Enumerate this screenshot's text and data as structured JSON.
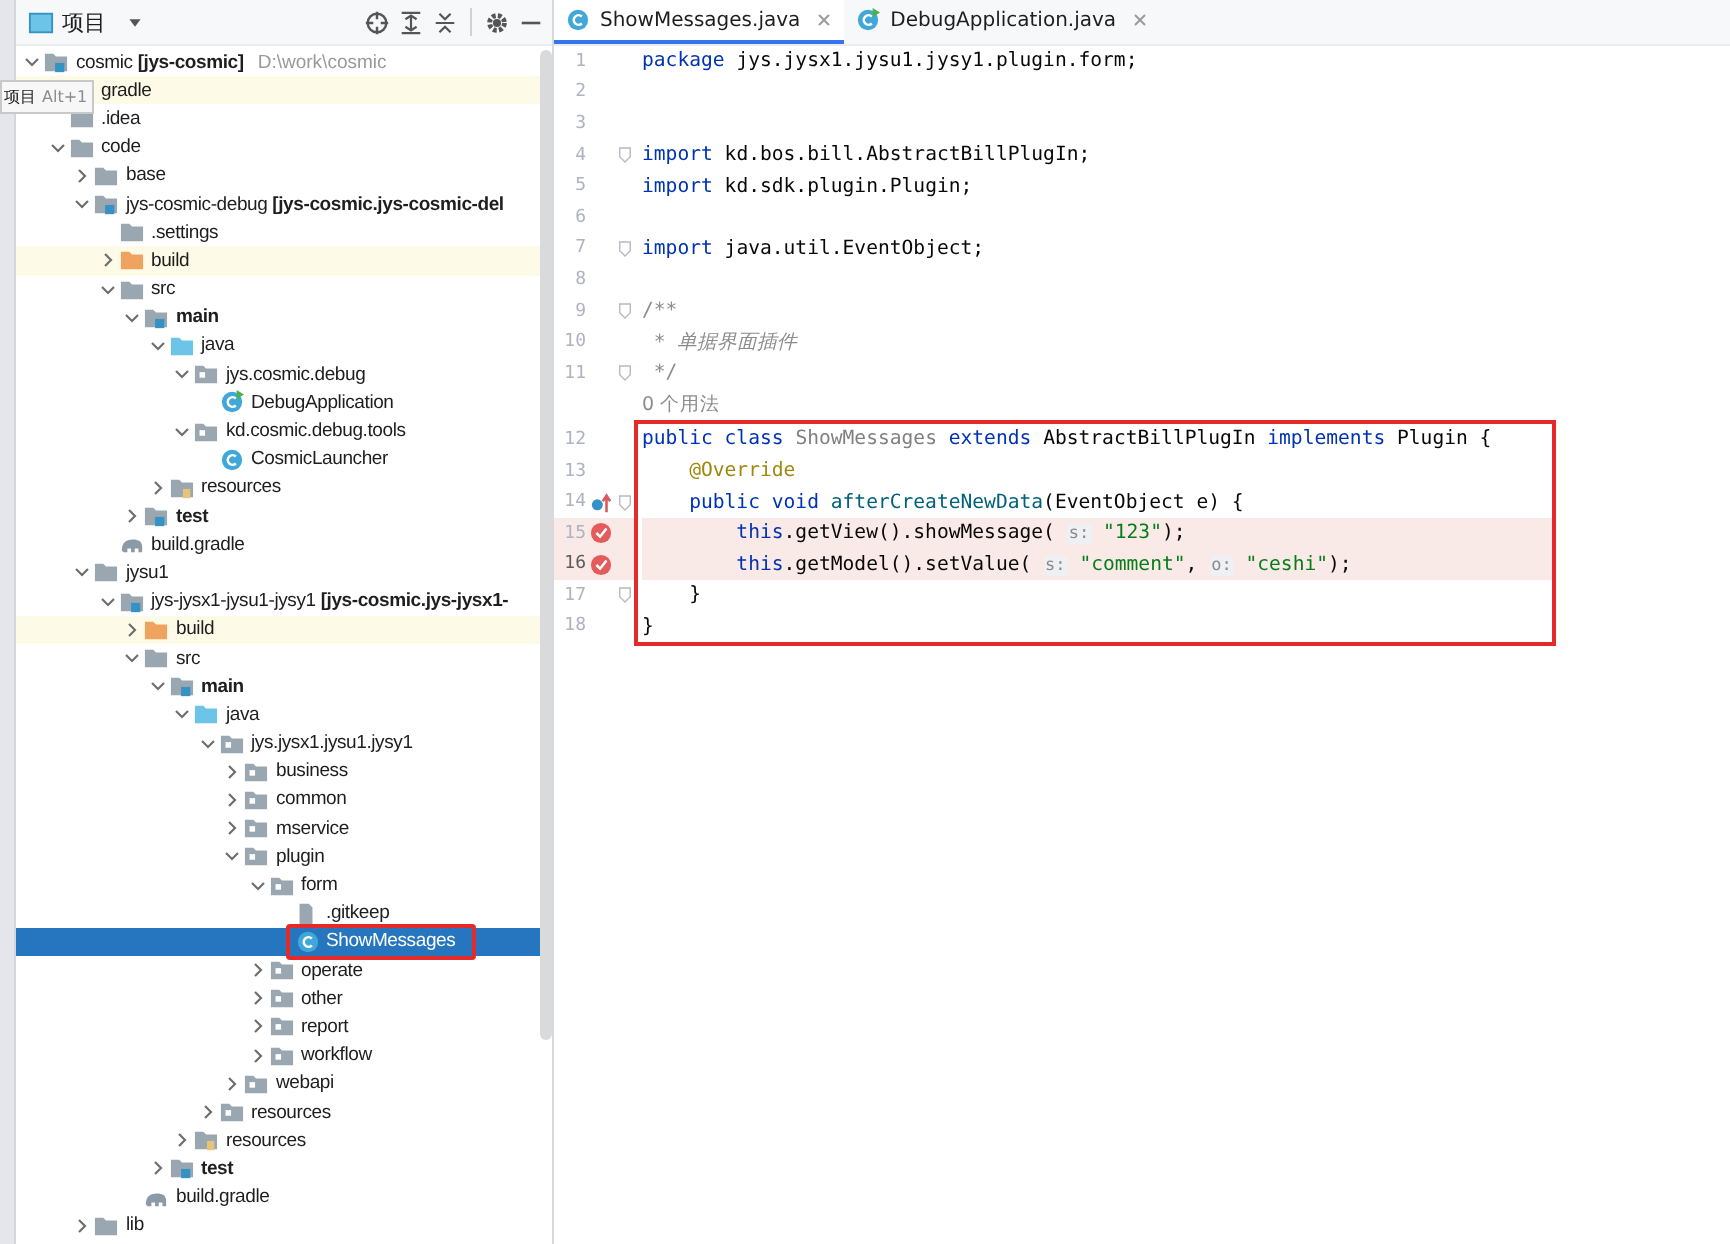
{
  "project_panel": {
    "title": "项目",
    "tooltip": {
      "label": "项目",
      "shortcut": "Alt+1"
    }
  },
  "tree": [
    {
      "label": "cosmic **[jys-cosmic]**",
      "path": "D:\\work\\cosmic",
      "kind": "module",
      "expanded": true,
      "selected": false,
      "highlighted": false,
      "boxed": false,
      "children": [
        {
          "label": "gradle",
          "kind": "folder",
          "selected": false,
          "highlighted": true,
          "boxed": false
        },
        {
          "label": ".idea",
          "kind": "folder",
          "selected": false,
          "highlighted": false,
          "boxed": false
        },
        {
          "label": "code",
          "kind": "folder",
          "expanded": true,
          "selected": false,
          "highlighted": false,
          "boxed": false,
          "children": [
            {
              "label": "base",
              "kind": "folder",
              "expanded": false,
              "selected": false,
              "highlighted": false,
              "boxed": false
            },
            {
              "label": "jys-cosmic-debug **[jys-cosmic.jys-cosmic-del**",
              "kind": "module",
              "expanded": true,
              "selected": false,
              "highlighted": false,
              "boxed": false,
              "children": [
                {
                  "label": ".settings",
                  "kind": "folder",
                  "selected": false,
                  "highlighted": false,
                  "boxed": false
                },
                {
                  "label": "build",
                  "kind": "excluded",
                  "expanded": false,
                  "selected": false,
                  "highlighted": true,
                  "boxed": false
                },
                {
                  "label": "src",
                  "kind": "folder",
                  "expanded": true,
                  "selected": false,
                  "highlighted": false,
                  "boxed": false,
                  "children": [
                    {
                      "label": "main",
                      "kind": "source-root",
                      "expanded": true,
                      "selected": false,
                      "highlighted": false,
                      "boxed": false,
                      "children": [
                        {
                          "label": "java",
                          "kind": "java-root",
                          "expanded": true,
                          "selected": false,
                          "highlighted": false,
                          "boxed": false,
                          "children": [
                            {
                              "label": "jys.cosmic.debug",
                              "kind": "package",
                              "expanded": true,
                              "selected": false,
                              "highlighted": false,
                              "boxed": false,
                              "children": [
                                {
                                  "label": "DebugApplication",
                                  "kind": "runnable-class",
                                  "selected": false,
                                  "highlighted": false,
                                  "boxed": false
                                }
                              ]
                            },
                            {
                              "label": "kd.cosmic.debug.tools",
                              "kind": "package",
                              "expanded": true,
                              "selected": false,
                              "highlighted": false,
                              "boxed": false,
                              "children": [
                                {
                                  "label": "CosmicLauncher",
                                  "kind": "class",
                                  "selected": false,
                                  "highlighted": false,
                                  "boxed": false
                                }
                              ]
                            }
                          ]
                        },
                        {
                          "label": "resources",
                          "kind": "resources",
                          "expanded": false,
                          "selected": false,
                          "highlighted": false,
                          "boxed": false
                        }
                      ]
                    },
                    {
                      "label": "test",
                      "kind": "source-root",
                      "expanded": false,
                      "selected": false,
                      "highlighted": false,
                      "boxed": false
                    }
                  ]
                },
                {
                  "label": "build.gradle",
                  "kind": "gradle",
                  "selected": false,
                  "highlighted": false,
                  "boxed": false
                }
              ]
            },
            {
              "label": "jysu1",
              "kind": "folder",
              "expanded": true,
              "selected": false,
              "highlighted": false,
              "boxed": false,
              "children": [
                {
                  "label": "jys-jysx1-jysu1-jysy1 **[jys-cosmic.jys-jysx1-**",
                  "kind": "module",
                  "expanded": true,
                  "selected": false,
                  "highlighted": false,
                  "boxed": false,
                  "children": [
                    {
                      "label": "build",
                      "kind": "excluded",
                      "expanded": false,
                      "selected": false,
                      "highlighted": true,
                      "boxed": false
                    },
                    {
                      "label": "src",
                      "kind": "folder",
                      "expanded": true,
                      "selected": false,
                      "highlighted": false,
                      "boxed": false,
                      "children": [
                        {
                          "label": "main",
                          "kind": "source-root",
                          "expanded": true,
                          "selected": false,
                          "highlighted": false,
                          "boxed": false,
                          "children": [
                            {
                              "label": "java",
                              "kind": "java-root",
                              "expanded": true,
                              "selected": false,
                              "highlighted": false,
                              "boxed": false,
                              "children": [
                                {
                                  "label": "jys.jysx1.jysu1.jysy1",
                                  "kind": "package",
                                  "expanded": true,
                                  "selected": false,
                                  "highlighted": false,
                                  "boxed": false,
                                  "children": [
                                    {
                                      "label": "business",
                                      "kind": "package",
                                      "expanded": false,
                                      "selected": false,
                                      "highlighted": false,
                                      "boxed": false
                                    },
                                    {
                                      "label": "common",
                                      "kind": "package",
                                      "expanded": false,
                                      "selected": false,
                                      "highlighted": false,
                                      "boxed": false
                                    },
                                    {
                                      "label": "mservice",
                                      "kind": "package",
                                      "expanded": false,
                                      "selected": false,
                                      "highlighted": false,
                                      "boxed": false
                                    },
                                    {
                                      "label": "plugin",
                                      "kind": "package",
                                      "expanded": true,
                                      "selected": false,
                                      "highlighted": false,
                                      "boxed": false,
                                      "children": [
                                        {
                                          "label": "form",
                                          "kind": "package",
                                          "expanded": true,
                                          "selected": false,
                                          "highlighted": false,
                                          "boxed": false,
                                          "children": [
                                            {
                                              "label": ".gitkeep",
                                              "kind": "file",
                                              "selected": false,
                                              "highlighted": false,
                                              "boxed": false
                                            },
                                            {
                                              "label": "ShowMessages",
                                              "kind": "class",
                                              "selected": true,
                                              "highlighted": false,
                                              "boxed": true
                                            }
                                          ]
                                        },
                                        {
                                          "label": "operate",
                                          "kind": "package",
                                          "expanded": false,
                                          "selected": false,
                                          "highlighted": false,
                                          "boxed": false
                                        },
                                        {
                                          "label": "other",
                                          "kind": "package",
                                          "expanded": false,
                                          "selected": false,
                                          "highlighted": false,
                                          "boxed": false
                                        },
                                        {
                                          "label": "report",
                                          "kind": "package",
                                          "expanded": false,
                                          "selected": false,
                                          "highlighted": false,
                                          "boxed": false
                                        },
                                        {
                                          "label": "workflow",
                                          "kind": "package",
                                          "expanded": false,
                                          "selected": false,
                                          "highlighted": false,
                                          "boxed": false
                                        }
                                      ]
                                    },
                                    {
                                      "label": "webapi",
                                      "kind": "package",
                                      "expanded": false,
                                      "selected": false,
                                      "highlighted": false,
                                      "boxed": false
                                    }
                                  ]
                                },
                                {
                                  "label": "resources",
                                  "kind": "package",
                                  "expanded": false,
                                  "selected": false,
                                  "highlighted": false,
                                  "boxed": false
                                }
                              ]
                            },
                            {
                              "label": "resources",
                              "kind": "resources",
                              "expanded": false,
                              "selected": false,
                              "highlighted": false,
                              "boxed": false
                            }
                          ]
                        },
                        {
                          "label": "test",
                          "kind": "source-root",
                          "expanded": false,
                          "selected": false,
                          "highlighted": false,
                          "boxed": false
                        }
                      ]
                    },
                    {
                      "label": "build.gradle",
                      "kind": "gradle",
                      "selected": false,
                      "highlighted": false,
                      "boxed": false
                    }
                  ]
                }
              ]
            },
            {
              "label": "lib",
              "kind": "folder",
              "expanded": false,
              "selected": false,
              "highlighted": false,
              "boxed": false
            }
          ]
        }
      ]
    }
  ],
  "tabs": [
    {
      "label": "ShowMessages.java",
      "kind": "class",
      "selected": true
    },
    {
      "label": "DebugApplication.java",
      "kind": "runnable-class",
      "selected": false
    }
  ],
  "code_blocks": [
    {
      "boxed": false,
      "lines": [
        {
          "kind": "code",
          "number": "1",
          "current": false,
          "tokens": [
            {
              "kind": "keyword",
              "text": "package "
            },
            {
              "kind": "plain",
              "text": "jys.jysx1.jysu1.jysy1.plugin.form;"
            }
          ]
        },
        {
          "kind": "code",
          "number": "2",
          "current": false
        },
        {
          "kind": "code",
          "number": "3",
          "current": false
        },
        {
          "kind": "code",
          "number": "4",
          "fold": true,
          "current": false,
          "tokens": [
            {
              "kind": "keyword",
              "text": "import "
            },
            {
              "kind": "plain",
              "text": "kd.bos.bill.AbstractBillPlugIn;"
            }
          ]
        },
        {
          "kind": "code",
          "number": "5",
          "current": false,
          "tokens": [
            {
              "kind": "keyword",
              "text": "import "
            },
            {
              "kind": "plain",
              "text": "kd.sdk.plugin.Plugin;"
            }
          ]
        },
        {
          "kind": "code",
          "number": "6",
          "current": false
        },
        {
          "kind": "code",
          "number": "7",
          "fold": true,
          "current": false,
          "tokens": [
            {
              "kind": "keyword",
              "text": "import "
            },
            {
              "kind": "plain",
              "text": "java.util.EventObject;"
            }
          ]
        },
        {
          "kind": "code",
          "number": "8",
          "current": false
        },
        {
          "kind": "code",
          "number": "9",
          "fold": true,
          "current": false,
          "tokens": [
            {
              "kind": "comment",
              "text": "/**"
            }
          ]
        },
        {
          "kind": "code",
          "number": "10",
          "current": false,
          "tokens": [
            {
              "kind": "comment",
              "text": " * "
            },
            {
              "kind": "doc",
              "text": "单据界面插件"
            }
          ]
        },
        {
          "kind": "code",
          "number": "11",
          "fold": true,
          "current": false,
          "tokens": [
            {
              "kind": "comment",
              "text": " */"
            }
          ]
        },
        {
          "kind": "inlay",
          "text": "0 个用法"
        }
      ]
    },
    {
      "boxed": true,
      "lines": [
        {
          "kind": "code",
          "number": "12",
          "current": false,
          "tokens": [
            {
              "kind": "keyword",
              "text": "public class "
            },
            {
              "kind": "unused",
              "text": "ShowMessages"
            },
            {
              "kind": "keyword",
              "text": " extends "
            },
            {
              "kind": "plain",
              "text": "AbstractBillPlugIn"
            },
            {
              "kind": "keyword",
              "text": " implements "
            },
            {
              "kind": "plain",
              "text": "Plugin {"
            }
          ]
        },
        {
          "kind": "code",
          "number": "13",
          "current": false,
          "tokens": [
            {
              "kind": "annotation",
              "text": "    @Override"
            }
          ]
        },
        {
          "kind": "override",
          "number": "14",
          "fold": true,
          "current": false,
          "tokens": [
            {
              "kind": "keyword",
              "text": "    public void "
            },
            {
              "kind": "method",
              "text": "afterCreateNewData"
            },
            {
              "kind": "plain",
              "text": "(EventObject e) {"
            }
          ]
        },
        {
          "kind": "breakpoint",
          "number": "15",
          "current": false,
          "tokens": [
            {
              "kind": "keyword",
              "text": "        this"
            },
            {
              "kind": "plain",
              "text": ".getView().showMessage( "
            },
            {
              "kind": "hint",
              "text": "s:"
            },
            {
              "kind": "string",
              "text": " \"123\""
            },
            {
              "kind": "plain",
              "text": ");"
            }
          ]
        },
        {
          "kind": "breakpoint",
          "number": "16",
          "current": true,
          "tokens": [
            {
              "kind": "keyword",
              "text": "        this"
            },
            {
              "kind": "plain",
              "text": ".getModel().setValue( "
            },
            {
              "kind": "hint",
              "text": "s:"
            },
            {
              "kind": "string",
              "text": " \"comment\""
            },
            {
              "kind": "plain",
              "text": ", "
            },
            {
              "kind": "hint",
              "text": "o:"
            },
            {
              "kind": "string",
              "text": " \"ceshi\""
            },
            {
              "kind": "plain",
              "text": ");"
            }
          ]
        },
        {
          "kind": "code",
          "number": "17",
          "fold": true,
          "current": false,
          "tokens": [
            {
              "kind": "plain",
              "text": "    }"
            }
          ]
        },
        {
          "kind": "code",
          "number": "18",
          "current": false,
          "tokens": [
            {
              "kind": "plain",
              "text": "}"
            }
          ]
        }
      ]
    }
  ]
}
